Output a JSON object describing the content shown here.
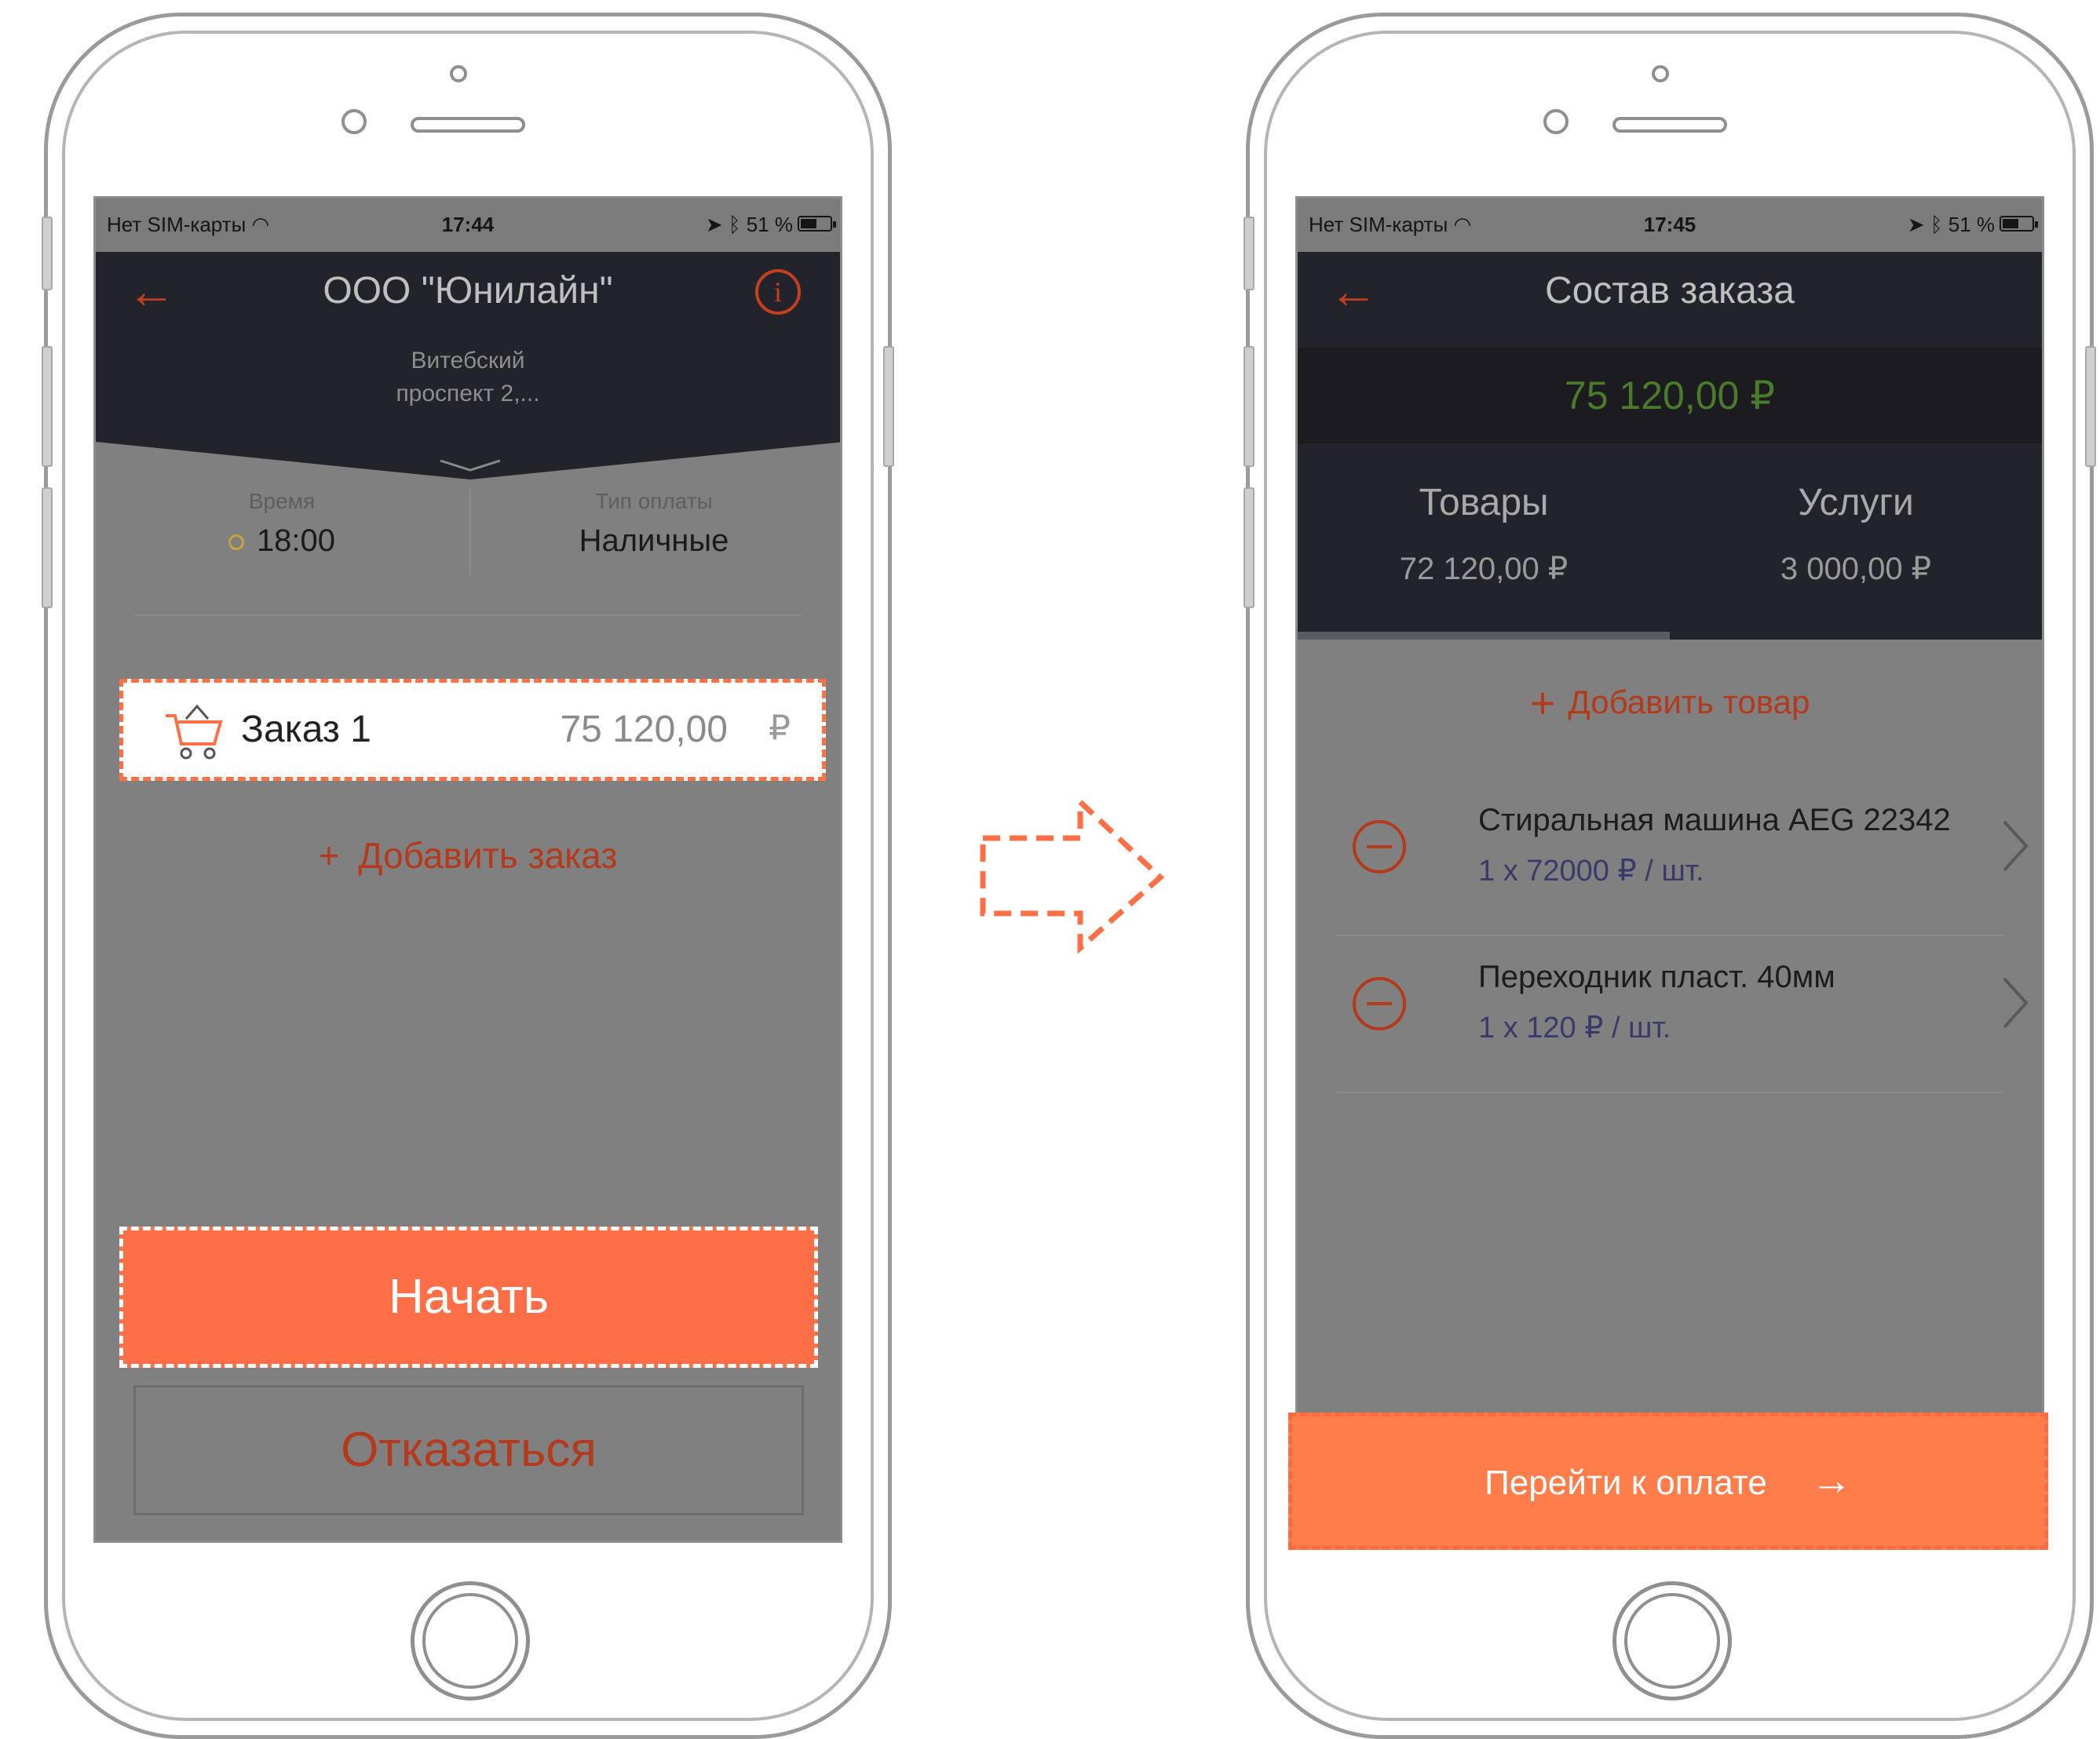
{
  "status_left": {
    "carrier": "Нет SIM-карты",
    "time": "17:44",
    "battery": "51 %"
  },
  "status_right": {
    "carrier": "Нет SIM-карты",
    "time": "17:45",
    "battery": "51 %"
  },
  "left_screen": {
    "title": "ООО \"Юнилайн\"",
    "address_line1": "Витебский",
    "address_line2": "проспект 2,...",
    "time_label": "Время",
    "time_value": "18:00",
    "payment_label": "Тип оплаты",
    "payment_value": "Наличные",
    "order": {
      "name": "Заказ 1",
      "sum": "75 120,00",
      "currency": "₽"
    },
    "add_order_plus": "+",
    "add_order_label": "Добавить заказ",
    "start_button": "Начать",
    "cancel_button": "Отказаться"
  },
  "right_screen": {
    "title": "Состав заказа",
    "total": "75 120,00 ₽",
    "tabs": [
      {
        "name": "Товары",
        "sum": "72 120,00 ₽"
      },
      {
        "name": "Услуги",
        "sum": "3 000,00 ₽"
      }
    ],
    "add_goods_plus": "+",
    "add_goods_label": "Добавить товар",
    "items": [
      {
        "name": "Стиральная машина AEG 22342",
        "qty": "1 x 72000 ₽ / шт."
      },
      {
        "name": "Переходник пласт. 40мм",
        "qty": "1 x 120 ₽ / шт."
      }
    ],
    "pay_button": "Перейти к оплате",
    "pay_arrow": "→"
  },
  "icons": {
    "back": "←",
    "info": "i",
    "colors": {
      "accent": "#ff6f47",
      "accent_text": "#b5391b",
      "total_green": "#4a7b2a",
      "nav_dark": "#23232c"
    }
  }
}
